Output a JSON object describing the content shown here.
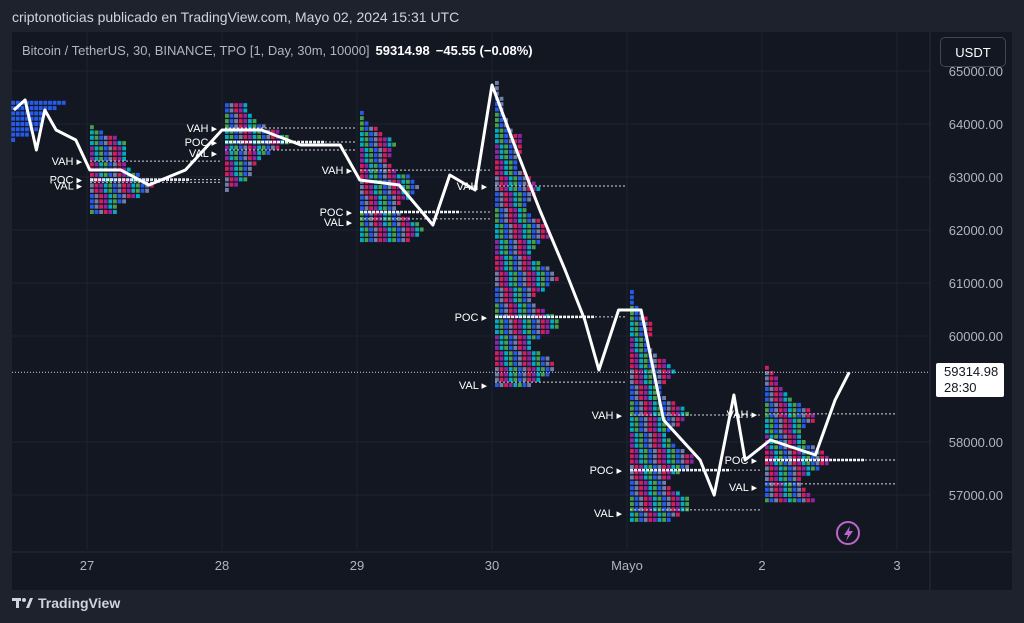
{
  "header": {
    "published": "criptonoticias publicado en TradingView.com, Mayo 02, 2024 15:31 UTC"
  },
  "legend": {
    "symbol": "Bitcoin / TetherUS, 30, BINANCE, TPO [1, Day, 30m, 10000]",
    "last": "59314.98",
    "change": "−45.55 (−0.08%)"
  },
  "currency_button": "USDT",
  "footer": {
    "logo": "TradingView"
  },
  "last_price_label": {
    "price": "59314.98",
    "countdown": "28:30"
  },
  "colors": {
    "background": "#131722",
    "price_line": "#ffffff",
    "profile_a": "#e91e63",
    "profile_b": "#00bcd4",
    "profile_c": "#4caf50",
    "profile_d": "#2962ff",
    "lightning": "#ba68c8"
  },
  "icons": {
    "alert": "lightning-icon",
    "logo": "tradingview-logo-icon"
  },
  "chart_data": {
    "type": "line",
    "title": "",
    "ylim": [
      56000,
      65000
    ],
    "y_ticks": [
      "65000.00",
      "64000.00",
      "63000.00",
      "62000.00",
      "61000.00",
      "60000.00",
      "58000.00",
      "57000.00"
    ],
    "y_tick_values": [
      65000,
      64000,
      63000,
      62000,
      61000,
      60000,
      58000,
      57000
    ],
    "x_ticks": [
      {
        "label": "27",
        "t": "2024-04-27T00:00"
      },
      {
        "label": "28",
        "t": "2024-04-28T00:00"
      },
      {
        "label": "29",
        "t": "2024-04-29T00:00"
      },
      {
        "label": "30",
        "t": "2024-04-30T00:00"
      },
      {
        "label": "Mayo",
        "t": "2024-05-01T00:00"
      },
      {
        "label": "2",
        "t": "2024-05-02T00:00"
      },
      {
        "label": "3",
        "t": "2024-05-03T00:00"
      }
    ],
    "last_price": 59314.98,
    "series": [
      {
        "points": [
          [
            "2024-04-26T11:00",
            64264
          ],
          [
            "2024-04-26T13:00",
            64453
          ],
          [
            "2024-04-26T15:00",
            63509
          ],
          [
            "2024-04-26T16:30",
            64264
          ],
          [
            "2024-04-26T18:30",
            63887
          ],
          [
            "2024-04-26T22:00",
            63698
          ],
          [
            "2024-04-27T00:30",
            63132
          ],
          [
            "2024-04-27T06:00",
            63132
          ],
          [
            "2024-04-27T11:00",
            62849
          ],
          [
            "2024-04-27T17:30",
            63132
          ],
          [
            "2024-04-28T00:00",
            63887
          ],
          [
            "2024-04-28T07:00",
            63887
          ],
          [
            "2024-04-28T14:00",
            63604
          ],
          [
            "2024-04-28T21:00",
            63604
          ],
          [
            "2024-04-29T00:30",
            62943
          ],
          [
            "2024-04-29T07:30",
            62849
          ],
          [
            "2024-04-29T13:30",
            62094
          ],
          [
            "2024-04-29T16:30",
            63038
          ],
          [
            "2024-04-29T21:00",
            62755
          ],
          [
            "2024-04-30T00:00",
            64736
          ],
          [
            "2024-04-30T04:00",
            63604
          ],
          [
            "2024-04-30T08:30",
            62377
          ],
          [
            "2024-04-30T13:00",
            61245
          ],
          [
            "2024-04-30T16:30",
            60302
          ],
          [
            "2024-04-30T19:00",
            59358
          ],
          [
            "2024-04-30T22:30",
            60491
          ],
          [
            "2024-05-01T02:30",
            60491
          ],
          [
            "2024-05-01T06:30",
            58415
          ],
          [
            "2024-05-01T13:00",
            57660
          ],
          [
            "2024-05-01T15:30",
            56999
          ],
          [
            "2024-05-01T19:00",
            58887
          ],
          [
            "2024-05-01T21:00",
            57660
          ],
          [
            "2024-05-02T01:30",
            58038
          ],
          [
            "2024-05-02T09:30",
            57755
          ],
          [
            "2024-05-02T13:00",
            58792
          ],
          [
            "2024-05-02T15:30",
            59315
          ]
        ]
      }
    ],
    "tpo_sessions": [
      {
        "start": "2024-04-26T10:00",
        "high": 64480,
        "low": 63700,
        "poc": 64350
      },
      {
        "start": "2024-04-27T00:00",
        "high": 63980,
        "low": 62340,
        "vah": 63300,
        "poc": 62950,
        "val": 62900,
        "labels": [
          "VAH",
          "POC",
          "VAL"
        ]
      },
      {
        "start": "2024-04-28T00:00",
        "high": 64360,
        "low": 62755,
        "vah": 63925,
        "poc": 63660,
        "val": 63510,
        "labels": [
          "VAH",
          "POC",
          "VAL"
        ]
      },
      {
        "start": "2024-04-29T00:00",
        "high": 64260,
        "low": 61810,
        "vah": 63130,
        "poc": 62340,
        "val": 62210,
        "labels": [
          "VAH",
          "POC",
          "VAL"
        ]
      },
      {
        "start": "2024-04-30T00:00",
        "high": 64790,
        "low": 59075,
        "vah": 62830,
        "poc": 60360,
        "val": 59130,
        "labels": [
          "VAH",
          "POC",
          "VAL"
        ]
      },
      {
        "start": "2024-05-01T00:00",
        "high": 60870,
        "low": 56530,
        "vah": 58510,
        "poc": 57470,
        "val": 56720,
        "labels": [
          "VAH",
          "POC",
          "VAL"
        ]
      },
      {
        "start": "2024-05-02T00:00",
        "high": 59450,
        "low": 56900,
        "vah": 58530,
        "poc": 57660,
        "val": 57210,
        "labels": [
          "VAH",
          "POC",
          "VAL"
        ]
      }
    ]
  }
}
